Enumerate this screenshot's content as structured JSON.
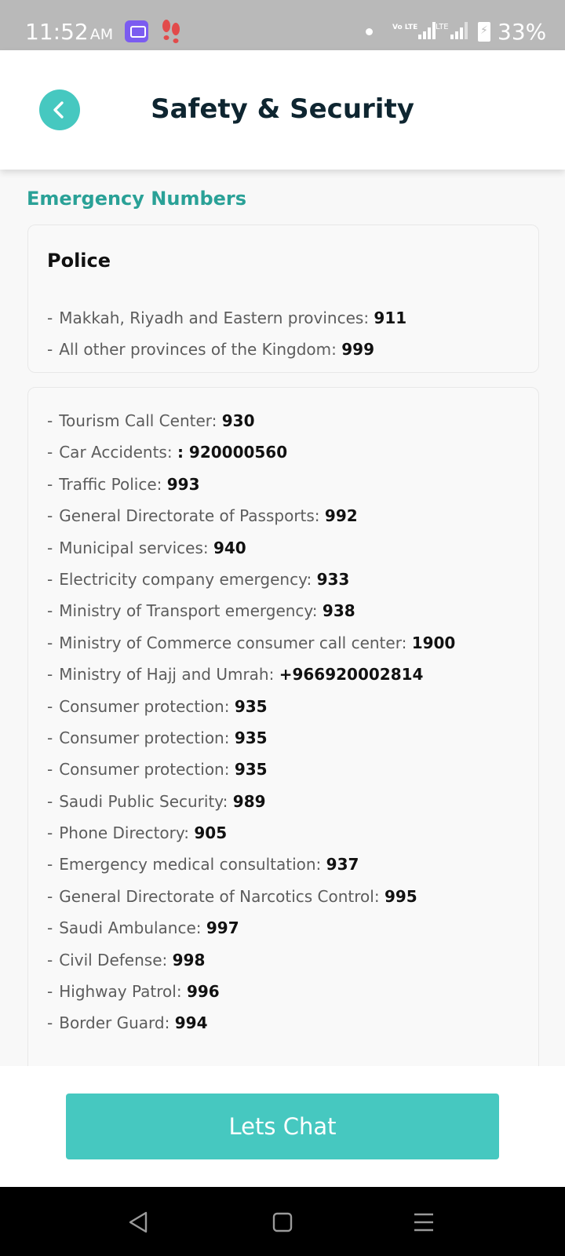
{
  "status_bar": {
    "time": "11:52",
    "ampm": "AM",
    "network_label": "Vo LTE",
    "lte_label": "LTE",
    "battery": "33%",
    "icons": [
      "chat-notification-icon",
      "footsteps-icon",
      "dot-icon",
      "volte-icon",
      "signal-icon",
      "signal-icon",
      "battery-charging-icon"
    ]
  },
  "header": {
    "title": "Safety & Security",
    "back_icon": "chevron-left-icon"
  },
  "section": {
    "title": "Emergency Numbers"
  },
  "police_card": {
    "heading": "Police",
    "items": [
      {
        "label": "Makkah, Riyadh and Eastern provinces:",
        "number": "911"
      },
      {
        "label": "All other provinces of the Kingdom:",
        "number": "999"
      }
    ]
  },
  "other_card": {
    "items": [
      {
        "label": "Tourism Call Center:",
        "number": "930"
      },
      {
        "label": "Car Accidents:",
        "number": ": 920000560"
      },
      {
        "label": "Traffic Police:",
        "number": "993"
      },
      {
        "label": "General Directorate of Passports:",
        "number": "992"
      },
      {
        "label": "Municipal services:",
        "number": "940"
      },
      {
        "label": "Electricity company emergency:",
        "number": "933"
      },
      {
        "label": "Ministry of Transport emergency:",
        "number": "938"
      },
      {
        "label": "Ministry of Commerce consumer call center:",
        "number": "1900"
      },
      {
        "label": "Ministry of Hajj and Umrah:",
        "number": "+966920002814"
      },
      {
        "label": "Consumer protection:",
        "number": "935"
      },
      {
        "label": "Consumer protection:",
        "number": "935"
      },
      {
        "label": "Consumer protection:",
        "number": "935"
      },
      {
        "label": "Saudi Public Security:",
        "number": "989"
      },
      {
        "label": "Phone Directory:",
        "number": "905"
      },
      {
        "label": "Emergency medical consultation:",
        "number": "937"
      },
      {
        "label": "General Directorate of Narcotics Control:",
        "number": "995"
      },
      {
        "label": "Saudi Ambulance:",
        "number": "997"
      },
      {
        "label": "Civil Defense:",
        "number": "998"
      },
      {
        "label": "Highway Patrol:",
        "number": "996"
      },
      {
        "label": "Border Guard:",
        "number": "994"
      }
    ]
  },
  "chat": {
    "button_label": "Lets Chat"
  },
  "colors": {
    "accent": "#46c8c0",
    "section_title": "#2aa197",
    "title_text": "#0e2530"
  },
  "nav_icons": [
    "back-triangle-icon",
    "home-square-icon",
    "menu-lines-icon"
  ]
}
